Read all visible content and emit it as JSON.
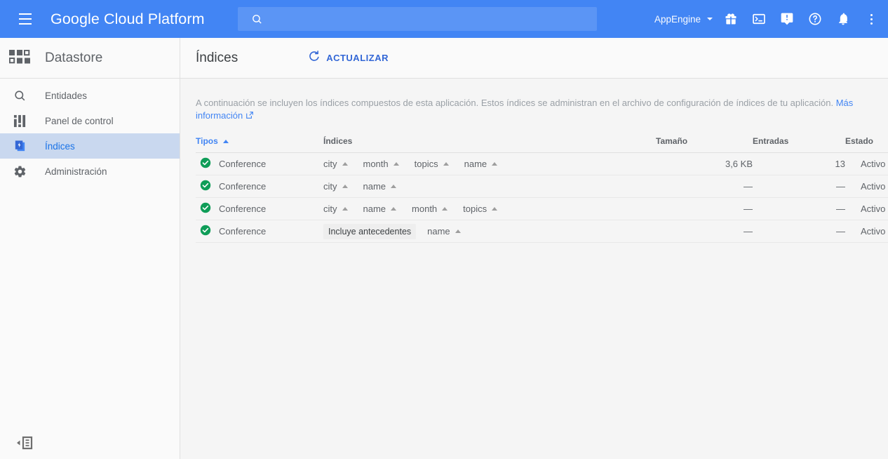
{
  "topbar": {
    "menu_icon": "hamburger-menu-icon",
    "brand_google": "Google ",
    "brand_cloud": "Cloud Platform",
    "search": {
      "value": "",
      "placeholder": "",
      "icon": "search-icon"
    },
    "project": "AppEngine",
    "icons": [
      {
        "name": "gift-icon",
        "title": "Novedades"
      },
      {
        "name": "cloud-shell-icon",
        "title": "Cloud Shell"
      },
      {
        "name": "feedback-icon",
        "title": "Comentarios"
      },
      {
        "name": "help-icon",
        "title": "Ayuda"
      },
      {
        "name": "notifications-bell-icon",
        "title": "Notificaciones"
      },
      {
        "name": "more-options-icon",
        "title": "Más opciones"
      }
    ]
  },
  "sidebar": {
    "product_title": "Datastore",
    "product_icon": "datastore-grid-icon",
    "items": [
      {
        "label": "Entidades",
        "icon": "search-icon",
        "active": false
      },
      {
        "label": "Panel de control",
        "icon": "dashboard-icon",
        "active": false
      },
      {
        "label": "Índices",
        "icon": "indexes-icon",
        "active": true
      },
      {
        "label": "Administración",
        "icon": "gear-icon",
        "active": false
      }
    ],
    "collapse_icon": "collapse-sidebar-icon"
  },
  "main": {
    "page_title": "Índices",
    "refresh_label": "ACTUALIZAR",
    "refresh_icon": "refresh-icon",
    "description": "A continuación se incluyen los índices compuestos de esta aplicación. Estos índices se administran en el archivo de configuración de índices de tu aplicación.",
    "description_link": "Más información",
    "link_icon": "external-link-icon"
  },
  "table": {
    "headers": {
      "type": "Tipos",
      "indexes": "Índices",
      "size": "Tamaño",
      "entries": "Entradas",
      "status": "Estado"
    },
    "sort_column": "Tipos",
    "sort_direction": "asc",
    "rows": [
      {
        "status_icon": "check-circle-icon",
        "type": "Conference",
        "chip": null,
        "properties": [
          {
            "name": "city",
            "dir": "asc"
          },
          {
            "name": "month",
            "dir": "asc"
          },
          {
            "name": "topics",
            "dir": "asc"
          },
          {
            "name": "name",
            "dir": "asc"
          }
        ],
        "size": "3,6 KB",
        "entries": "13",
        "status": "Activo"
      },
      {
        "status_icon": "check-circle-icon",
        "type": "Conference",
        "chip": null,
        "properties": [
          {
            "name": "city",
            "dir": "asc"
          },
          {
            "name": "name",
            "dir": "asc"
          }
        ],
        "size": "—",
        "entries": "—",
        "status": "Activo"
      },
      {
        "status_icon": "check-circle-icon",
        "type": "Conference",
        "chip": null,
        "properties": [
          {
            "name": "city",
            "dir": "asc"
          },
          {
            "name": "name",
            "dir": "asc"
          },
          {
            "name": "month",
            "dir": "asc"
          },
          {
            "name": "topics",
            "dir": "asc"
          }
        ],
        "size": "—",
        "entries": "—",
        "status": "Activo"
      },
      {
        "status_icon": "check-circle-icon",
        "type": "Conference",
        "chip": "Incluye antecedentes",
        "properties": [
          {
            "name": "name",
            "dir": "asc"
          }
        ],
        "size": "—",
        "entries": "—",
        "status": "Activo"
      }
    ]
  },
  "colors": {
    "header_blue": "#4285f4",
    "search_blue": "#5b95f5",
    "link_blue": "#4285f4",
    "action_blue": "#3367d6",
    "active_nav_bg": "#c9d8ef",
    "status_green": "#0f9d58",
    "chip_bg": "#eeeeee",
    "page_bg": "#f5f5f5",
    "panel_bg": "#fafafa"
  }
}
